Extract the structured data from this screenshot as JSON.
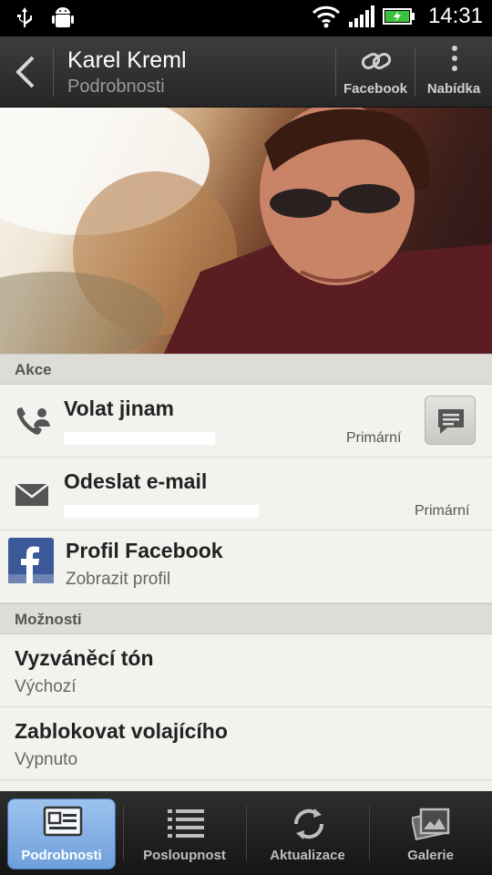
{
  "status_bar": {
    "time": "14:31",
    "icons": [
      "usb-icon",
      "android-debug-icon",
      "wifi-icon",
      "signal-icon",
      "battery-charging-icon"
    ]
  },
  "action_bar": {
    "title": "Karel Kreml",
    "subtitle": "Podrobnosti",
    "actions": [
      {
        "label": "Facebook",
        "icon": "link-icon"
      },
      {
        "label": "Nabídka",
        "icon": "overflow-menu-icon"
      }
    ]
  },
  "sections": {
    "actions_header": "Akce",
    "options_header": "Možnosti"
  },
  "actions": [
    {
      "title": "Volat jinam",
      "detail": "",
      "badge": "Primární",
      "icon": "phone-contact-icon",
      "side_button_icon": "message-icon"
    },
    {
      "title": "Odeslat e-mail",
      "detail": "",
      "badge": "Primární",
      "icon": "email-icon"
    },
    {
      "title": "Profil Facebook",
      "detail": "Zobrazit profil",
      "icon": "facebook-icon"
    }
  ],
  "options": [
    {
      "title": "Vyzváněcí tón",
      "value": "Výchozí"
    },
    {
      "title": "Zablokovat volajícího",
      "value": "Vypnuto"
    }
  ],
  "tabs": [
    {
      "label": "Podrobnosti",
      "icon": "contact-card-icon",
      "active": true
    },
    {
      "label": "Posloupnost",
      "icon": "list-icon",
      "active": false
    },
    {
      "label": "Aktualizace",
      "icon": "refresh-icon",
      "active": false
    },
    {
      "label": "Galerie",
      "icon": "gallery-icon",
      "active": false
    }
  ],
  "colors": {
    "tab_active": "#7aa9e2",
    "facebook_blue": "#3b5998",
    "action_bar": "#2f2f2f"
  }
}
